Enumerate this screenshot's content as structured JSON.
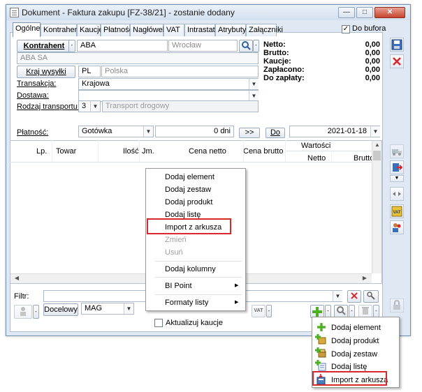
{
  "window": {
    "title": "Dokument - Faktura zakupu [FZ-38/21]  - zostanie dodany",
    "min_label": "—",
    "max_label": "□",
    "close_label": "✕"
  },
  "tabs": [
    "Ogólne",
    "Kontrahent",
    "Kaucje",
    "Płatności",
    "Nagłówek",
    "VAT",
    "Intrastat",
    "Atrybuty",
    "Załączniki"
  ],
  "do_bufora": {
    "label": "Do bufora",
    "checked": "✓"
  },
  "contractor": {
    "button": "Kontrahent",
    "code": "ABA",
    "city": "Wrocław",
    "name": "ABA SA"
  },
  "summary": [
    {
      "label": "Netto:",
      "value": "0,00"
    },
    {
      "label": "Brutto:",
      "value": "0,00"
    },
    {
      "label": "Kaucje:",
      "value": "0,00"
    },
    {
      "label": "Zapłacono:",
      "value": "0,00"
    },
    {
      "label": "Do zapłaty:",
      "value": "0,00"
    }
  ],
  "country": {
    "button": "Kraj wysyłki",
    "code": "PL",
    "name": "Polska"
  },
  "transakcja": {
    "label": "Transakcja:",
    "value": "Krajowa"
  },
  "dostawa": {
    "label": "Dostawa:",
    "value": ""
  },
  "transport": {
    "label": "Rodzaj transportu:",
    "code": "3",
    "placeholder": "Transport drogowy"
  },
  "payment": {
    "label": "Płatność:",
    "method": "Gotówka",
    "days": "0 dni",
    "arrow_btn": ">>",
    "do_btn": "Do",
    "date": "2021-01-18"
  },
  "grid": {
    "group_header": "Wartości",
    "columns": [
      "Lp.",
      "Towar",
      "Ilość",
      "Jm.",
      "Cena netto",
      "Cena brutto",
      "Netto",
      "Brutto"
    ]
  },
  "context_menu": {
    "items": [
      {
        "label": "Dodaj element",
        "disabled": false
      },
      {
        "label": "Dodaj zestaw",
        "disabled": false
      },
      {
        "label": "Dodaj produkt",
        "disabled": false
      },
      {
        "label": "Dodaj listę",
        "disabled": false
      },
      {
        "label": "Import z arkusza",
        "disabled": false
      },
      {
        "label": "Zmień",
        "disabled": true
      },
      {
        "label": "Usuń",
        "disabled": true
      },
      {
        "label": "Dodaj kolumny",
        "disabled": false
      },
      {
        "label": "BI Point",
        "disabled": false
      },
      {
        "label": "Formaty listy",
        "disabled": false
      }
    ],
    "submenu_arrow": "▶"
  },
  "filter": {
    "label": "Filtr:"
  },
  "bottom": {
    "docelowy": "Docelowy",
    "warehouse": "MAG",
    "vat_icon": "VAT",
    "aktualizuj": "Aktualizuj kaucje"
  },
  "add_menu": {
    "items": [
      {
        "label": "Dodaj element",
        "icon": "plus-icon"
      },
      {
        "label": "Dodaj produkt",
        "icon": "add-product-icon"
      },
      {
        "label": "Dodaj zestaw",
        "icon": "add-set-icon"
      },
      {
        "label": "Dodaj listę",
        "icon": "add-list-icon"
      },
      {
        "label": "Import z arkusza",
        "icon": "spreadsheet-import-icon"
      }
    ]
  },
  "colors": {
    "highlight": "#d9272e",
    "accent_green": "#4caf24",
    "window_border": "#6f8fb5"
  }
}
